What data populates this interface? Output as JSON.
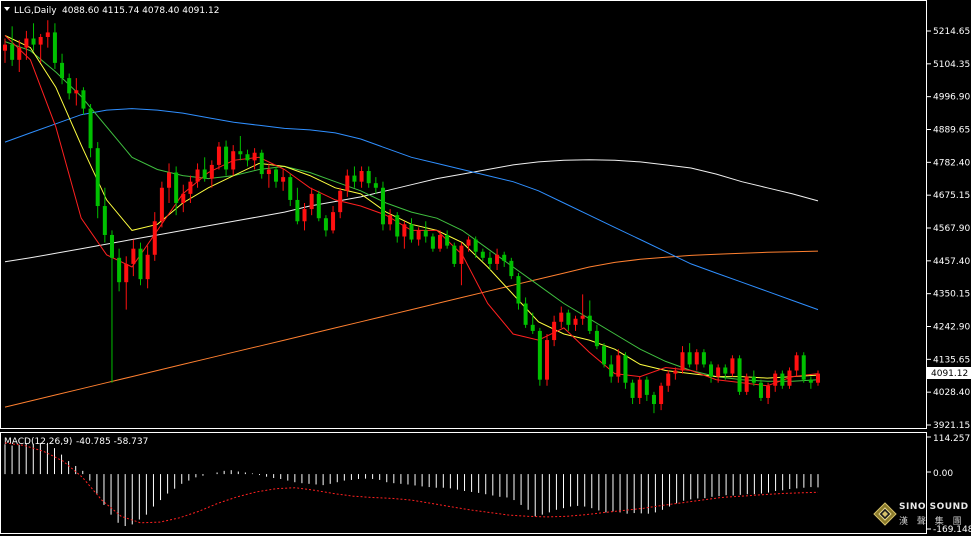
{
  "header": {
    "symbol_label": "LLG,Daily",
    "ohlc_text": "4088.60 4115.74 4078.40 4091.12"
  },
  "macd": {
    "label": "MACD(12,26,9)",
    "values_text": "-40.785 -58.737",
    "axis_top": "114.257",
    "axis_zero": "0.00",
    "axis_bottom": "-169.148"
  },
  "price_axis": {
    "ticks": [
      "5214.65",
      "5104.35",
      "4996.90",
      "4889.65",
      "4782.40",
      "4675.15",
      "4567.90",
      "4457.40",
      "4350.15",
      "4242.90",
      "4135.65",
      "4028.40",
      "3921.15"
    ],
    "current_label": "4091.12"
  },
  "logo": {
    "brand": "SINO SOUND",
    "chinese": "漢 聲 集 團"
  },
  "colors": {
    "background": "#000000",
    "up_candle": "#ff1010",
    "down_candle": "#00c000",
    "ma_red": "#ff2020",
    "ma_yellow": "#ffff40",
    "ma_green": "#40c040",
    "ma_blue": "#2f8fff",
    "ma_white": "#f0f0f0",
    "ma_orange": "#ff8030",
    "macd_hist": "#ffffff",
    "macd_signal": "#ff2020"
  },
  "chart_data": {
    "type": "candlestick",
    "price_range": [
      3921.15,
      5250
    ],
    "macd_range": [
      -169.148,
      114.257
    ],
    "candles": [
      [
        5150,
        5190,
        5110,
        5170
      ],
      [
        5170,
        5230,
        5100,
        5120
      ],
      [
        5120,
        5185,
        5080,
        5160
      ],
      [
        5160,
        5215,
        5120,
        5190
      ],
      [
        5190,
        5240,
        5150,
        5170
      ],
      [
        5170,
        5205,
        5110,
        5195
      ],
      [
        5195,
        5250,
        5160,
        5210
      ],
      [
        5210,
        5240,
        5090,
        5110
      ],
      [
        5110,
        5140,
        5040,
        5060
      ],
      [
        5060,
        5075,
        4990,
        5010
      ],
      [
        5010,
        5060,
        4970,
        5020
      ],
      [
        5020,
        5030,
        4940,
        4960
      ],
      [
        4960,
        4975,
        4800,
        4830
      ],
      [
        4830,
        4850,
        4600,
        4640
      ],
      [
        4640,
        4700,
        4520,
        4545
      ],
      [
        4545,
        4560,
        4060,
        4470
      ],
      [
        4470,
        4500,
        4360,
        4390
      ],
      [
        4390,
        4475,
        4300,
        4450
      ],
      [
        4450,
        4530,
        4410,
        4500
      ],
      [
        4500,
        4520,
        4380,
        4400
      ],
      [
        4400,
        4510,
        4370,
        4480
      ],
      [
        4480,
        4620,
        4460,
        4590
      ],
      [
        4590,
        4720,
        4570,
        4700
      ],
      [
        4700,
        4780,
        4650,
        4750
      ],
      [
        4750,
        4770,
        4610,
        4650
      ],
      [
        4650,
        4710,
        4620,
        4680
      ],
      [
        4680,
        4740,
        4650,
        4720
      ],
      [
        4720,
        4780,
        4700,
        4760
      ],
      [
        4760,
        4800,
        4720,
        4730
      ],
      [
        4730,
        4790,
        4700,
        4775
      ],
      [
        4775,
        4850,
        4760,
        4835
      ],
      [
        4835,
        4855,
        4740,
        4760
      ],
      [
        4760,
        4840,
        4740,
        4820
      ],
      [
        4820,
        4870,
        4790,
        4810
      ],
      [
        4810,
        4825,
        4770,
        4790
      ],
      [
        4790,
        4830,
        4760,
        4815
      ],
      [
        4815,
        4825,
        4730,
        4745
      ],
      [
        4745,
        4780,
        4700,
        4760
      ],
      [
        4760,
        4770,
        4700,
        4720
      ],
      [
        4720,
        4760,
        4690,
        4735
      ],
      [
        4735,
        4745,
        4640,
        4660
      ],
      [
        4660,
        4700,
        4580,
        4590
      ],
      [
        4590,
        4650,
        4560,
        4630
      ],
      [
        4630,
        4700,
        4610,
        4680
      ],
      [
        4680,
        4690,
        4590,
        4600
      ],
      [
        4600,
        4610,
        4540,
        4560
      ],
      [
        4560,
        4640,
        4550,
        4620
      ],
      [
        4620,
        4700,
        4600,
        4690
      ],
      [
        4690,
        4760,
        4670,
        4740
      ],
      [
        4740,
        4770,
        4700,
        4720
      ],
      [
        4720,
        4770,
        4700,
        4755
      ],
      [
        4755,
        4770,
        4700,
        4715
      ],
      [
        4715,
        4735,
        4680,
        4700
      ],
      [
        4700,
        4720,
        4560,
        4580
      ],
      [
        4580,
        4630,
        4560,
        4610
      ],
      [
        4610,
        4620,
        4520,
        4540
      ],
      [
        4540,
        4590,
        4500,
        4580
      ],
      [
        4580,
        4600,
        4520,
        4530
      ],
      [
        4530,
        4570,
        4510,
        4560
      ],
      [
        4560,
        4590,
        4520,
        4540
      ],
      [
        4540,
        4550,
        4490,
        4500
      ],
      [
        4500,
        4560,
        4490,
        4545
      ],
      [
        4545,
        4560,
        4500,
        4510
      ],
      [
        4510,
        4520,
        4440,
        4450
      ],
      [
        4450,
        4520,
        4380,
        4510
      ],
      [
        4510,
        4540,
        4490,
        4530
      ],
      [
        4530,
        4540,
        4470,
        4490
      ],
      [
        4490,
        4500,
        4460,
        4470
      ],
      [
        4470,
        4490,
        4430,
        4450
      ],
      [
        4450,
        4500,
        4430,
        4480
      ],
      [
        4480,
        4490,
        4440,
        4460
      ],
      [
        4460,
        4470,
        4400,
        4410
      ],
      [
        4410,
        4420,
        4300,
        4320
      ],
      [
        4320,
        4340,
        4240,
        4250
      ],
      [
        4250,
        4290,
        4220,
        4230
      ],
      [
        4230,
        4240,
        4050,
        4070
      ],
      [
        4070,
        4220,
        4050,
        4200
      ],
      [
        4200,
        4280,
        4180,
        4260
      ],
      [
        4260,
        4310,
        4240,
        4290
      ],
      [
        4290,
        4300,
        4230,
        4250
      ],
      [
        4250,
        4280,
        4230,
        4270
      ],
      [
        4270,
        4350,
        4250,
        4280
      ],
      [
        4280,
        4330,
        4220,
        4230
      ],
      [
        4230,
        4250,
        4170,
        4180
      ],
      [
        4180,
        4190,
        4110,
        4120
      ],
      [
        4120,
        4150,
        4060,
        4080
      ],
      [
        4080,
        4170,
        4060,
        4150
      ],
      [
        4150,
        4160,
        4040,
        4060
      ],
      [
        4060,
        4070,
        3990,
        4010
      ],
      [
        4010,
        4080,
        3990,
        4070
      ],
      [
        4070,
        4080,
        4000,
        4020
      ],
      [
        4020,
        4030,
        3960,
        3990
      ],
      [
        3990,
        4060,
        3970,
        4050
      ],
      [
        4050,
        4100,
        4030,
        4090
      ],
      [
        4090,
        4110,
        4070,
        4100
      ],
      [
        4100,
        4180,
        4090,
        4160
      ],
      [
        4160,
        4190,
        4110,
        4120
      ],
      [
        4120,
        4170,
        4100,
        4160
      ],
      [
        4160,
        4170,
        4110,
        4120
      ],
      [
        4120,
        4130,
        4060,
        4080
      ],
      [
        4080,
        4120,
        4060,
        4110
      ],
      [
        4110,
        4120,
        4070,
        4090
      ],
      [
        4090,
        4150,
        4080,
        4140
      ],
      [
        4140,
        4150,
        4020,
        4030
      ],
      [
        4030,
        4090,
        4020,
        4080
      ],
      [
        4080,
        4100,
        4050,
        4060
      ],
      [
        4060,
        4070,
        4000,
        4010
      ],
      [
        4010,
        4060,
        3990,
        4050
      ],
      [
        4050,
        4100,
        4030,
        4090
      ],
      [
        4090,
        4100,
        4040,
        4050
      ],
      [
        4050,
        4110,
        4040,
        4100
      ],
      [
        4100,
        4160,
        4080,
        4150
      ],
      [
        4150,
        4160,
        4060,
        4070
      ],
      [
        4070,
        4080,
        4040,
        4060
      ],
      [
        4060,
        4100,
        4050,
        4090
      ]
    ],
    "ma_series": [
      {
        "color_key": "ma_white",
        "values": [
          4457,
          4470,
          4485,
          4500,
          4515,
          4530,
          4545,
          4560,
          4575,
          4590,
          4605,
          4620,
          4640,
          4655,
          4670,
          4690,
          4710,
          4730,
          4745,
          4760,
          4775,
          4785,
          4790,
          4792,
          4790,
          4785,
          4775,
          4765,
          4745,
          4720,
          4700,
          4680,
          4657
        ]
      },
      {
        "color_key": "ma_orange",
        "values": [
          3980,
          4000,
          4020,
          4040,
          4060,
          4080,
          4100,
          4120,
          4140,
          4160,
          4180,
          4200,
          4220,
          4240,
          4260,
          4280,
          4300,
          4320,
          4340,
          4360,
          4380,
          4400,
          4420,
          4440,
          4455,
          4465,
          4472,
          4478,
          4482,
          4485,
          4488,
          4490,
          4492
        ]
      },
      {
        "color_key": "ma_blue",
        "values": [
          4850,
          4880,
          4910,
          4940,
          4955,
          4960,
          4955,
          4945,
          4930,
          4915,
          4905,
          4895,
          4890,
          4880,
          4860,
          4830,
          4800,
          4780,
          4760,
          4740,
          4720,
          4690,
          4650,
          4610,
          4570,
          4530,
          4490,
          4450,
          4420,
          4390,
          4360,
          4330,
          4300
        ]
      },
      {
        "color_key": "ma_green",
        "values": [
          5180,
          5150,
          5080,
          5000,
          4900,
          4800,
          4760,
          4740,
          4730,
          4740,
          4760,
          4770,
          4750,
          4720,
          4690,
          4650,
          4620,
          4600,
          4560,
          4500,
          4440,
          4380,
          4320,
          4270,
          4220,
          4170,
          4130,
          4100,
          4080,
          4070,
          4065,
          4065,
          4070
        ]
      },
      {
        "color_key": "ma_yellow",
        "values": [
          5200,
          5160,
          5030,
          4840,
          4660,
          4560,
          4580,
          4650,
          4700,
          4740,
          4780,
          4770,
          4740,
          4700,
          4680,
          4620,
          4580,
          4560,
          4520,
          4440,
          4350,
          4260,
          4220,
          4200,
          4170,
          4120,
          4100,
          4090,
          4080,
          4080,
          4075,
          4080,
          4085
        ]
      },
      {
        "color_key": "ma_red",
        "values": [
          5200,
          5120,
          4900,
          4600,
          4480,
          4440,
          4560,
          4680,
          4750,
          4790,
          4800,
          4760,
          4700,
          4660,
          4640,
          4610,
          4560,
          4560,
          4480,
          4320,
          4220,
          4200,
          4240,
          4160,
          4090,
          4080,
          4110,
          4100,
          4070,
          4060,
          4050,
          4080,
          4090
        ]
      }
    ],
    "macd_hist": [
      92,
      88,
      90,
      95,
      94,
      96,
      93,
      80,
      60,
      40,
      25,
      10,
      -20,
      -60,
      -95,
      -125,
      -150,
      -160,
      -155,
      -140,
      -125,
      -100,
      -80,
      -60,
      -45,
      -30,
      -20,
      -10,
      -5,
      0,
      5,
      10,
      12,
      8,
      5,
      2,
      -3,
      -8,
      -12,
      -15,
      -20,
      -25,
      -28,
      -30,
      -32,
      -34,
      -30,
      -25,
      -20,
      -18,
      -15,
      -14,
      -15,
      -18,
      -25,
      -28,
      -30,
      -32,
      -35,
      -38,
      -40,
      -42,
      -42,
      -44,
      -48,
      -52,
      -55,
      -58,
      -62,
      -66,
      -70,
      -72,
      -80,
      -95,
      -110,
      -130,
      -125,
      -118,
      -110,
      -105,
      -100,
      -98,
      -100,
      -105,
      -112,
      -118,
      -115,
      -118,
      -122,
      -120,
      -121,
      -122,
      -118,
      -110,
      -100,
      -90,
      -82,
      -78,
      -75,
      -74,
      -70,
      -68,
      -65,
      -66,
      -64,
      -62,
      -62,
      -60,
      -57,
      -52,
      -50,
      -46,
      -44,
      -42,
      -40,
      -41
    ],
    "macd_signal": [
      96,
      88,
      70,
      40,
      -10,
      -80,
      -130,
      -150,
      -148,
      -135,
      -115,
      -90,
      -70,
      -55,
      -45,
      -42,
      -50,
      -60,
      -68,
      -72,
      -75,
      -80,
      -90,
      -100,
      -110,
      -118,
      -126,
      -130,
      -132,
      -130,
      -125,
      -118,
      -112,
      -105,
      -96,
      -88,
      -80,
      -72,
      -68,
      -64,
      -60,
      -58,
      -56
    ]
  }
}
